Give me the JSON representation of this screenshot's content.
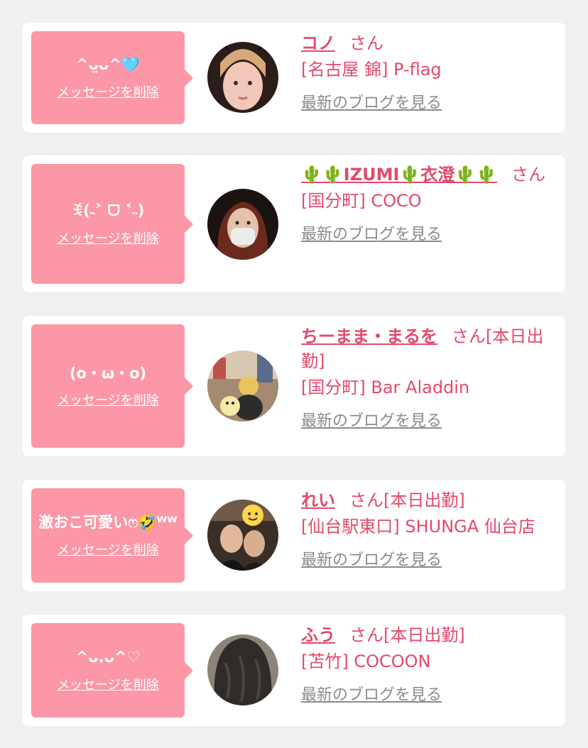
{
  "colors": {
    "accent": "#e4496a",
    "bubble": "#fb97a7",
    "link_gray": "#8a8a8a",
    "background": "#f0f0f2"
  },
  "delete_label": "メッセージを削除",
  "blog_label": "最新のブログを見る",
  "san_label": "さん",
  "items": [
    {
      "message": "^ᴗ̤ᴗ^🩵",
      "name": "コノ",
      "suffix": "",
      "shop": "[名古屋 錦] P-flag"
    },
    {
      "message": "ꉂ(˵˃ ᗜ ˂˵)",
      "name": "🌵🌵IZUMI🌵衣澄🌵🌵",
      "suffix": "",
      "shop": "[国分町] COCO"
    },
    {
      "message": "(o・ω・o)",
      "name": "ちーまま・まるを",
      "suffix": "[本日出勤]",
      "shop": "[国分町] Bar Aladdin"
    },
    {
      "message": "激おこ可愛いෆ🤣ᵂᵂ",
      "name": "れい",
      "suffix": "[本日出勤]",
      "shop": "[仙台駅東口] SHUNGA 仙台店"
    },
    {
      "message": "^ᴗ.ᴗ^♡",
      "name": "ふう",
      "suffix": "[本日出勤]",
      "shop": "[苫竹] COCOON"
    }
  ]
}
